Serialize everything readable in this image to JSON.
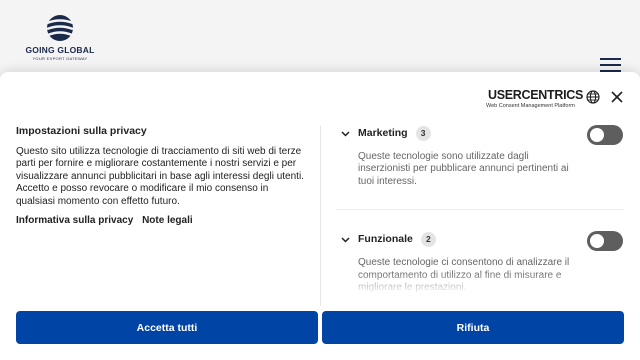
{
  "site": {
    "logo_name": "GOING GLOBAL",
    "logo_tagline": "YOUR EXPORT GATEWAY",
    "menu_icon": "hamburger-menu-icon"
  },
  "cmp": {
    "brand_name": "USERCENTRICS",
    "brand_sub": "Web Consent Management Platform",
    "language_icon": "globe-icon",
    "close_icon": "close-icon",
    "title": "Impostazioni sulla privacy",
    "description": "Questo sito utilizza tecnologie di tracciamento di siti web di terze parti per fornire e migliorare costantemente i nostri servizi e per visualizzare annunci pubblicitari in base agli interessi degli utenti. Accetto e posso revocare o modificare il mio consenso in qualsiasi momento con effetto futuro.",
    "links": {
      "privacy_info": "Informativa sulla privacy",
      "legal_notes": "Note legali"
    },
    "categories": [
      {
        "title": "Marketing",
        "count": "3",
        "description": "Queste tecnologie sono utilizzate dagli inserzionisti per pubblicare annunci pertinenti ai tuoi interessi.",
        "enabled": false
      },
      {
        "title": "Funzionale",
        "count": "2",
        "description": "Queste tecnologie ci consentono di analizzare il comportamento di utilizzo al fine di misurare e migliorare le prestazioni.",
        "enabled": false
      }
    ],
    "buttons": {
      "accept_all": "Accetta tutti",
      "deny": "Rifiuta"
    },
    "colors": {
      "primary": "#0045a5",
      "toggle_off": "#5e5e5e",
      "brand_dark": "#1b2a4a"
    }
  }
}
